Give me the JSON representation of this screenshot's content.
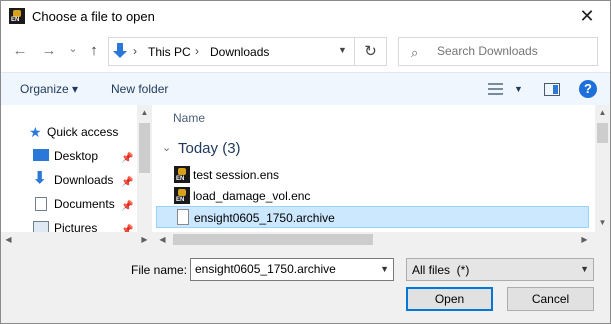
{
  "window": {
    "title": "Choose a file to open",
    "close_glyph": "✕"
  },
  "nav": {
    "back_glyph": "←",
    "forward_glyph": "→",
    "recent_glyph": "⌄",
    "up_glyph": "↑",
    "breadcrumb": [
      "This PC",
      "Downloads"
    ],
    "separator": "›",
    "refresh_glyph": "↻",
    "search_placeholder": "Search Downloads",
    "search_glyph": "⌕"
  },
  "toolbar": {
    "organize": "Organize ▾",
    "new_folder": "New folder",
    "help": "?"
  },
  "sidebar": {
    "items": [
      {
        "label": "Quick access",
        "icon": "star-icon"
      },
      {
        "label": "Desktop",
        "icon": "desktop-icon",
        "pinned": true
      },
      {
        "label": "Downloads",
        "icon": "download-icon",
        "pinned": true
      },
      {
        "label": "Documents",
        "icon": "document-icon",
        "pinned": true
      },
      {
        "label": "Pictures",
        "icon": "pictures-icon",
        "pinned": true
      }
    ],
    "pin_glyph": "📌"
  },
  "files": {
    "column_header": "Name",
    "group": {
      "label": "Today (3)",
      "chevron": "⌄"
    },
    "items": [
      {
        "name": "test session.ens",
        "icon": "ensight-icon",
        "selected": false
      },
      {
        "name": "load_damage_vol.enc",
        "icon": "ensight-icon",
        "selected": false
      },
      {
        "name": "ensight0605_1750.archive",
        "icon": "file-icon",
        "selected": true
      }
    ]
  },
  "bottom": {
    "file_name_label": "File name:",
    "file_name_value": "ensight0605_1750.archive",
    "filter": "All files  (*)",
    "open_button": "Open",
    "cancel_button": "Cancel"
  },
  "colors": {
    "accent": "#0078d7",
    "selection": "#cce8ff",
    "toolbar_bg": "#f0f6fd"
  }
}
